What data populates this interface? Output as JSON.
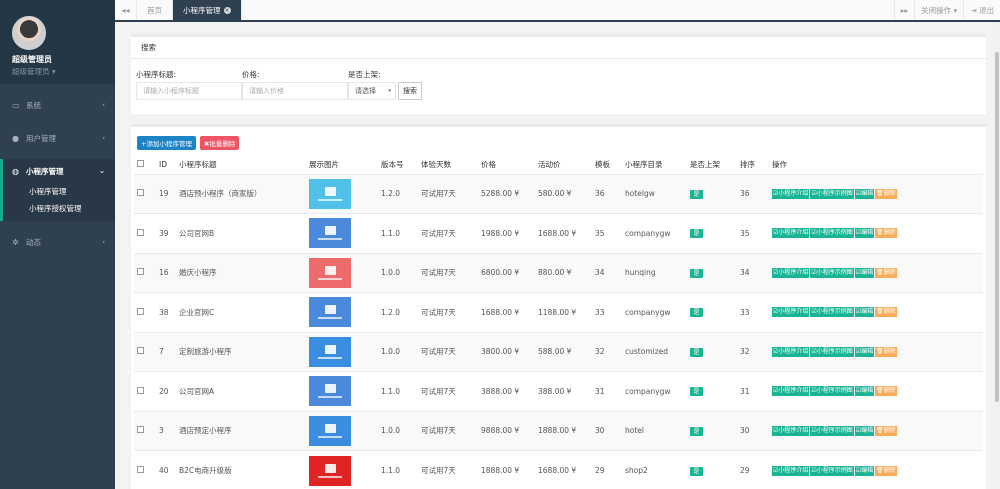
{
  "sidebar": {
    "user_name": "超级管理员",
    "user_role": "超级管理员 ▾",
    "items": [
      {
        "label": "系统",
        "icon": "monitor-icon"
      },
      {
        "label": "用户管理",
        "icon": "user-icon"
      },
      {
        "label": "小程序管理",
        "icon": "chat-icon"
      },
      {
        "label": "动态",
        "icon": "gears-icon"
      }
    ],
    "sub_items": [
      {
        "label": "小程序管理"
      },
      {
        "label": "小程序授权管理"
      }
    ]
  },
  "tabs": {
    "left_arrow": "◂◂",
    "home": "首页",
    "active": "小程序管理",
    "right_arrow": "▸▸",
    "close_ops": "关闭操作 ▾",
    "logout": "⇥ 退出"
  },
  "search": {
    "title": "搜索",
    "title_label": "小程序标题:",
    "title_placeholder": "请输入小程序标题",
    "price_label": "价格:",
    "price_placeholder": "请输入价格",
    "online_label": "是否上架:",
    "online_selected": "请选择",
    "search_button": "搜索"
  },
  "toolbar": {
    "add_label": "+添加小程序管理",
    "delete_label": "✖批量删除"
  },
  "table": {
    "headers": [
      "",
      "ID",
      "小程序标题",
      "展示图片",
      "版本号",
      "体验天数",
      "价格",
      "活动价",
      "模板",
      "小程序目录",
      "是否上架",
      "排序",
      "操作"
    ],
    "rows": [
      {
        "id": "19",
        "title": "酒店预小程序（商家版）",
        "version": "1.2.0",
        "days": "可试用7天",
        "price": "5288.00 ¥",
        "activity": "580.00 ¥",
        "template": "36",
        "dir": "hotelgw",
        "online": "是",
        "sort": "36",
        "color": "#4fc1e9"
      },
      {
        "id": "39",
        "title": "公司官网B",
        "version": "1.1.0",
        "days": "可试用7天",
        "price": "1988.00 ¥",
        "activity": "1688.00 ¥",
        "template": "35",
        "dir": "companygw",
        "online": "是",
        "sort": "35",
        "color": "#4a89dc"
      },
      {
        "id": "16",
        "title": "婚庆小程序",
        "version": "1.0.0",
        "days": "可试用7天",
        "price": "6800.00 ¥",
        "activity": "880.00 ¥",
        "template": "34",
        "dir": "hunqing",
        "online": "是",
        "sort": "34",
        "color": "#ed6b6b"
      },
      {
        "id": "38",
        "title": "企业官网C",
        "version": "1.2.0",
        "days": "可试用7天",
        "price": "1688.00 ¥",
        "activity": "1188.00 ¥",
        "template": "33",
        "dir": "companygw",
        "online": "是",
        "sort": "33",
        "color": "#4a89dc"
      },
      {
        "id": "7",
        "title": "定制旅游小程序",
        "version": "1.0.0",
        "days": "可试用7天",
        "price": "3800.00 ¥",
        "activity": "588.00 ¥",
        "template": "32",
        "dir": "customized",
        "online": "是",
        "sort": "32",
        "color": "#3b8de0"
      },
      {
        "id": "20",
        "title": "公司官网A",
        "version": "1.1.0",
        "days": "可试用7天",
        "price": "3888.00 ¥",
        "activity": "388.00 ¥",
        "template": "31",
        "dir": "companygw",
        "online": "是",
        "sort": "31",
        "color": "#4a89dc"
      },
      {
        "id": "3",
        "title": "酒店预定小程序",
        "version": "1.0.0",
        "days": "可试用7天",
        "price": "9888.00 ¥",
        "activity": "1888.00 ¥",
        "template": "30",
        "dir": "hotel",
        "online": "是",
        "sort": "30",
        "color": "#3b8de0"
      },
      {
        "id": "40",
        "title": "B2C电商升级版",
        "version": "1.1.0",
        "days": "可试用7天",
        "price": "1888.00 ¥",
        "activity": "1688.00 ¥",
        "template": "29",
        "dir": "shop2",
        "online": "是",
        "sort": "29",
        "color": "#e02424"
      }
    ],
    "ops": [
      "☑小程序介绍",
      "☑小程序示例图",
      "☑编辑",
      "🗑删除"
    ]
  },
  "colors": {
    "sidebar": "#2f4050",
    "accent": "#1ab394",
    "primary": "#1c84c6",
    "danger": "#ed5565",
    "warning": "#f8ac59"
  }
}
